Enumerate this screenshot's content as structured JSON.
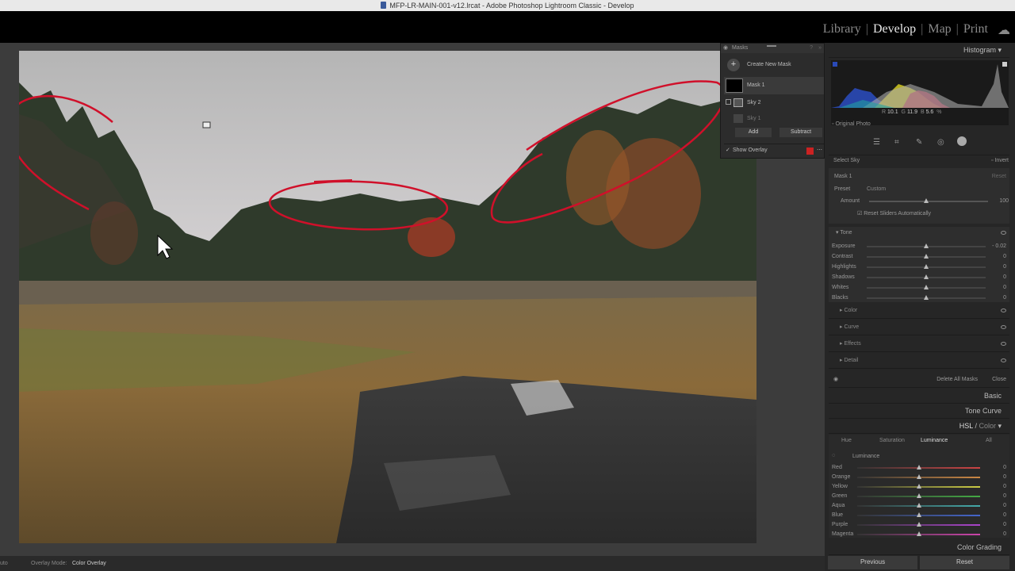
{
  "window": {
    "title": "MFP-LR-MAIN-001-v12.lrcat - Adobe Photoshop Lightroom Classic - Develop"
  },
  "modules": [
    "Library",
    "Develop",
    "Map",
    "Print"
  ],
  "active_module": "Develop",
  "masks_panel": {
    "title": "Masks",
    "create_label": "Create New Mask",
    "mask1": "Mask 1",
    "sky2": "Sky 2",
    "sky1": "Sky 1",
    "add_label": "Add",
    "subtract_label": "Subtract",
    "show_overlay_label": "Show Overlay",
    "overlay_color": "#cc2222"
  },
  "histogram": {
    "title": "Histogram",
    "readout": {
      "r_label": "R",
      "r": "10.1",
      "g_label": "G",
      "g": "11.9",
      "b_label": "B",
      "b": "5.6",
      "unit": "%"
    },
    "original_photo_label": "Original Photo"
  },
  "mask_settings": {
    "select_label": "Select Sky",
    "invert_label": "Invert",
    "mask_name": "Mask 1",
    "reset_label": "Reset",
    "preset_label": "Preset",
    "preset_value": "Custom",
    "amount_label": "Amount",
    "amount_value": "100",
    "amount_fraction": 1.0,
    "reset_sliders_label": "Reset Sliders Automatically",
    "tone_label": "Tone",
    "tone_sliders": [
      {
        "label": "Exposure",
        "value": "- 0.02",
        "pos": 0.5
      },
      {
        "label": "Contrast",
        "value": "0",
        "pos": 0.5
      },
      {
        "label": "Highlights",
        "value": "0",
        "pos": 0.5
      },
      {
        "label": "Shadows",
        "value": "0",
        "pos": 0.5
      },
      {
        "label": "Whites",
        "value": "0",
        "pos": 0.5
      },
      {
        "label": "Blacks",
        "value": "0",
        "pos": 0.5
      }
    ],
    "collapsed": [
      "Color",
      "Curve",
      "Effects",
      "Detail"
    ],
    "delete_all_label": "Delete All Masks",
    "close_label": "Close"
  },
  "sections": {
    "basic": "Basic",
    "tone_curve": "Tone Curve",
    "hsl": "HSL",
    "hsl_sep": " / ",
    "color": "Color",
    "color_grading": "Color Grading"
  },
  "hsl_panel": {
    "tabs": [
      "Hue",
      "Saturation",
      "Luminance",
      "All"
    ],
    "active_tab": "Luminance",
    "section_label": "Luminance",
    "sliders": [
      {
        "label": "Red",
        "value": "0",
        "pos": 0.5,
        "color": "#c44"
      },
      {
        "label": "Orange",
        "value": "0",
        "pos": 0.5,
        "color": "#c84"
      },
      {
        "label": "Yellow",
        "value": "0",
        "pos": 0.5,
        "color": "#cc4"
      },
      {
        "label": "Green",
        "value": "0",
        "pos": 0.5,
        "color": "#4a4"
      },
      {
        "label": "Aqua",
        "value": "0",
        "pos": 0.5,
        "color": "#4aa"
      },
      {
        "label": "Blue",
        "value": "0",
        "pos": 0.5,
        "color": "#46c"
      },
      {
        "label": "Purple",
        "value": "0",
        "pos": 0.5,
        "color": "#a4c"
      },
      {
        "label": "Magenta",
        "value": "0",
        "pos": 0.5,
        "color": "#c4a"
      }
    ]
  },
  "bottom": {
    "previous": "Previous",
    "reset": "Reset",
    "auto_fragment": "uto",
    "overlay_mode_label": "Overlay Mode:",
    "overlay_mode_value": "Color Overlay"
  }
}
